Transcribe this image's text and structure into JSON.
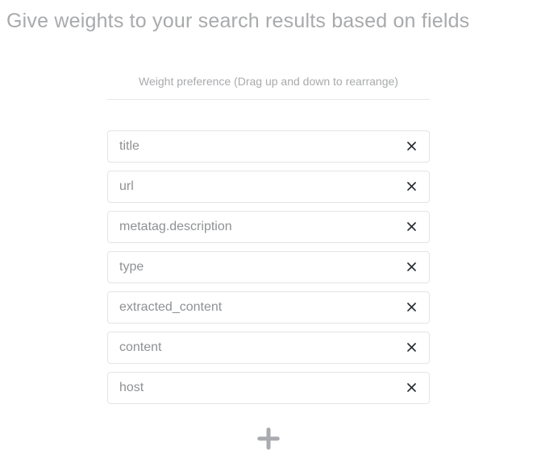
{
  "header": {
    "title": "Give weights to your search results based on fields"
  },
  "weights": {
    "subtitle": "Weight preference (Drag up and down to rearrange)",
    "fields": [
      {
        "name": "title"
      },
      {
        "name": "url"
      },
      {
        "name": "metatag.description"
      },
      {
        "name": "type"
      },
      {
        "name": "extracted_content"
      },
      {
        "name": "content"
      },
      {
        "name": "host"
      }
    ]
  }
}
